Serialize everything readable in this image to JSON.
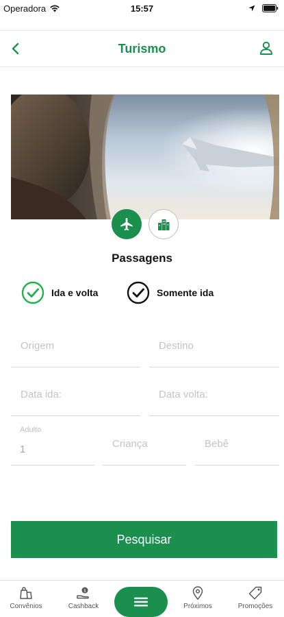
{
  "status_bar": {
    "carrier": "Operadora",
    "time": "15:57"
  },
  "nav": {
    "title": "Turismo"
  },
  "section": {
    "title": "Passagens"
  },
  "trip_type": {
    "round_trip": "Ida e volta",
    "one_way": "Somente ida"
  },
  "form": {
    "origin_placeholder": "Origem",
    "destination_placeholder": "Destino",
    "depart_placeholder": "Data ida:",
    "return_placeholder": "Data volta:",
    "adults_label": "Adulto",
    "adults_value": "1",
    "children_placeholder": "Criança",
    "infants_placeholder": "Bebê"
  },
  "search_button": "Pesquisar",
  "tabs": [
    {
      "label": "Convênios",
      "icon": "shopping-bag-icon"
    },
    {
      "label": "Cashback",
      "icon": "cashback-hand-icon"
    },
    {
      "label": "",
      "icon": "menu-icon"
    },
    {
      "label": "Próximos",
      "icon": "map-pin-icon"
    },
    {
      "label": "Promoções",
      "icon": "price-tag-icon"
    }
  ],
  "colors": {
    "brand_green": "#1b8f4e",
    "check_green": "#22b14c"
  }
}
